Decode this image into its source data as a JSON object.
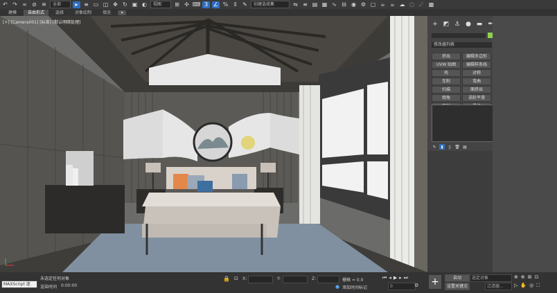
{
  "toolbar": {
    "undo_icon": "undo-icon",
    "redo_icon": "redo-icon",
    "filter_select": "全部",
    "view_select": "视图",
    "selection_set": "创建选择集"
  },
  "ribbon": {
    "tabs": [
      "建模",
      "自由形式",
      "选择",
      "对象绘制",
      "填充"
    ]
  },
  "viewport": {
    "label": "[+] [Camera001] [标准] [默认明暗处理]"
  },
  "command_panel": {
    "rollout_title": "修改器列表",
    "buttons": [
      "挤出",
      "编辑多边形",
      "UVW 贴图",
      "编辑样条线",
      "壳",
      "对称",
      "车削",
      "弯曲",
      "扫描",
      "面挤出",
      "倒角",
      "涡轮平滑",
      "车削",
      "晶格"
    ]
  },
  "status": {
    "maxscript_label": "MAXScript 迷",
    "selection": "未选定任何对象",
    "render_time_label": "渲染时间",
    "render_time_value": "0:00:00",
    "x_label": "X:",
    "y_label": "Y:",
    "z_label": "Z:",
    "grid_label": "栅格 = 0.0",
    "add_time_tag": "添加时间标记",
    "frame_value": "0",
    "auto_key": "自动",
    "set_key": "设置关键点",
    "selected_object": "选定对象",
    "filters": "过滤器..."
  },
  "colors": {
    "accent_blue": "#2f6fbf",
    "panel_bg": "#444444",
    "swatch_green": "#8fd14f"
  }
}
